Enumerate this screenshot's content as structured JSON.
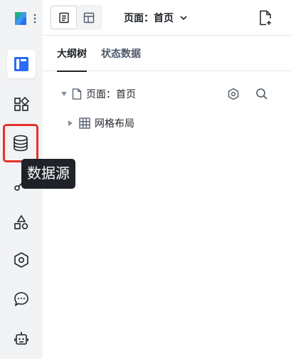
{
  "header": {
    "page_selector_label": "页面：首页"
  },
  "tabs": [
    {
      "label": "大纲树",
      "active": true
    },
    {
      "label": "状态数据",
      "active": false
    }
  ],
  "tree": {
    "root": {
      "label": "页面：首页",
      "icon": "file-icon",
      "expanded": true
    },
    "children": [
      {
        "label": "网格布局",
        "icon": "grid-icon",
        "expanded": false
      }
    ]
  },
  "tooltip": {
    "text": "数据源"
  },
  "sidebar": {
    "items": [
      {
        "name": "outline",
        "icon": "layout-panel-icon",
        "active": true
      },
      {
        "name": "components",
        "icon": "components-icon",
        "active": false
      },
      {
        "name": "datasource",
        "icon": "database-icon",
        "active": false,
        "highlighted": true
      },
      {
        "name": "logic",
        "icon": "flow-icon",
        "active": false
      },
      {
        "name": "shapes",
        "icon": "shapes-icon",
        "active": false
      },
      {
        "name": "settings",
        "icon": "hexagon-settings-icon",
        "active": false
      },
      {
        "name": "comments",
        "icon": "chat-icon",
        "active": false
      },
      {
        "name": "assistant",
        "icon": "robot-icon",
        "active": false
      }
    ]
  },
  "colors": {
    "accent_blue": "#2b6cf6",
    "highlight_red": "#e5322b",
    "rail_bg": "#f2f3f5"
  }
}
